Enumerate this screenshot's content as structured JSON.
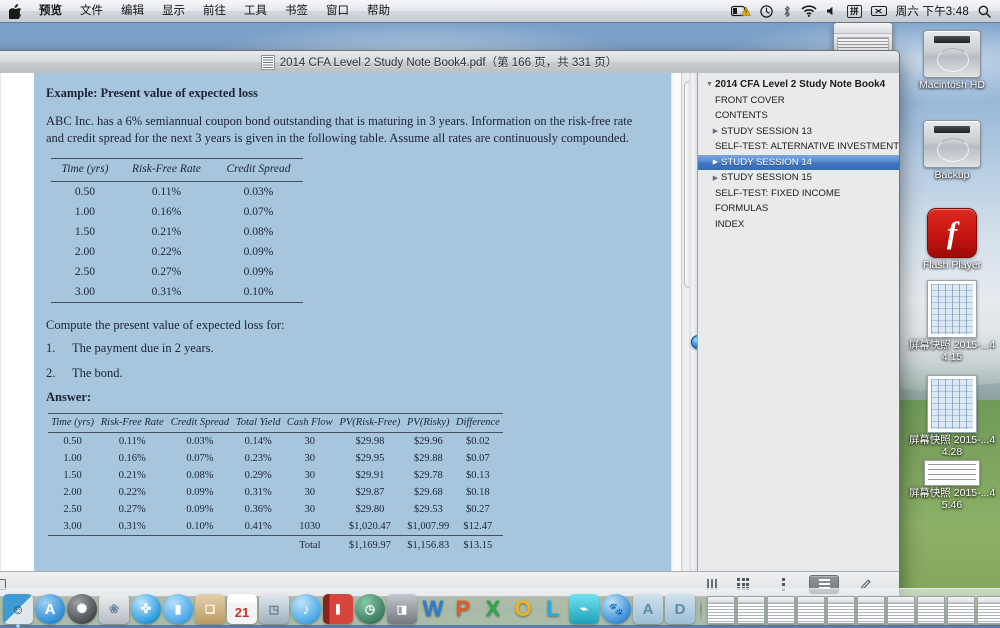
{
  "menubar": {
    "apple_icon": "apple-logo-icon",
    "items": [
      "预览",
      "文件",
      "编辑",
      "显示",
      "前往",
      "工具",
      "书签",
      "窗口",
      "帮助"
    ],
    "app_name": "预览",
    "status": {
      "battery_icon": "battery-warning-icon",
      "timemachine_icon": "time-machine-icon",
      "bluetooth_icon": "bluetooth-icon",
      "wifi_icon": "wifi-icon",
      "volume_icon": "volume-icon",
      "input_method": "拼",
      "input_switch_icon": "input-source-icon",
      "clock": "周六 下午3:48",
      "spotlight_icon": "search-icon"
    }
  },
  "window": {
    "title": "2014 CFA Level 2 Study Note Book4.pdf（第 166 页，共 331 页）",
    "doc_icon": "pdf-document-icon"
  },
  "pdf": {
    "heading": "Example: Present value of expected loss",
    "intro": "ABC Inc. has a 6% semiannual coupon bond outstanding that is maturing in 3 years. Information on the risk-free rate and credit spread for the next 3 years is given in the following table. Assume all rates are continuously compounded.",
    "table1": {
      "headers": [
        "Time (yrs)",
        "Risk-Free Rate",
        "Credit Spread"
      ],
      "rows": [
        [
          "0.50",
          "0.11%",
          "0.03%"
        ],
        [
          "1.00",
          "0.16%",
          "0.07%"
        ],
        [
          "1.50",
          "0.21%",
          "0.08%"
        ],
        [
          "2.00",
          "0.22%",
          "0.09%"
        ],
        [
          "2.50",
          "0.27%",
          "0.09%"
        ],
        [
          "3.00",
          "0.31%",
          "0.10%"
        ]
      ]
    },
    "prompt": "Compute the present value of expected loss for:",
    "list": [
      {
        "num": "1.",
        "text": "The payment due in 2 years."
      },
      {
        "num": "2.",
        "text": "The bond."
      }
    ],
    "answer_label": "Answer:",
    "table2": {
      "headers": [
        "Time (yrs)",
        "Risk-Free Rate",
        "Credit Spread",
        "Total Yield",
        "Cash Flow",
        "PV(Risk-Free)",
        "PV(Risky)",
        "Difference"
      ],
      "rows": [
        [
          "0.50",
          "0.11%",
          "0.03%",
          "0.14%",
          "30",
          "$29.98",
          "$29.96",
          "$0.02"
        ],
        [
          "1.00",
          "0.16%",
          "0.07%",
          "0.23%",
          "30",
          "$29.95",
          "$29.88",
          "$0.07"
        ],
        [
          "1.50",
          "0.21%",
          "0.08%",
          "0.29%",
          "30",
          "$29.91",
          "$29.78",
          "$0.13"
        ],
        [
          "2.00",
          "0.22%",
          "0.09%",
          "0.31%",
          "30",
          "$29.87",
          "$29.68",
          "$0.18"
        ],
        [
          "2.50",
          "0.27%",
          "0.09%",
          "0.36%",
          "30",
          "$29.80",
          "$29.53",
          "$0.27"
        ],
        [
          "3.00",
          "0.31%",
          "0.10%",
          "0.41%",
          "1030",
          "$1,020.47",
          "$1,007.99",
          "$12.47"
        ]
      ],
      "total_row": [
        "",
        "",
        "",
        "",
        "Total",
        "$1,169.97",
        "$1,156.83",
        "$13.15"
      ]
    }
  },
  "sidebar": {
    "items": [
      {
        "label": "2014 CFA Level 2 Study Note Book4",
        "level": 0,
        "twisty": "down",
        "selected": false
      },
      {
        "label": "FRONT COVER",
        "level": 1,
        "twisty": "none",
        "selected": false
      },
      {
        "label": "CONTENTS",
        "level": 1,
        "twisty": "none",
        "selected": false
      },
      {
        "label": "STUDY SESSION 13",
        "level": 1,
        "twisty": "right",
        "selected": false
      },
      {
        "label": "SELF-TEST: ALTERNATIVE INVESTMENTS",
        "level": 1,
        "twisty": "none",
        "selected": false
      },
      {
        "label": "STUDY SESSION 14",
        "level": 1,
        "twisty": "right",
        "selected": true
      },
      {
        "label": "STUDY SESSION 15",
        "level": 1,
        "twisty": "right",
        "selected": false
      },
      {
        "label": "SELF-TEST: FIXED INCOME",
        "level": 1,
        "twisty": "none",
        "selected": false
      },
      {
        "label": "FORMULAS",
        "level": 1,
        "twisty": "none",
        "selected": false
      },
      {
        "label": "INDEX",
        "level": 1,
        "twisty": "none",
        "selected": false
      }
    ],
    "selection_color": "#4076c0"
  },
  "toolbar": {
    "sidebar_toggle_icon": "sidebar-toggle-icon",
    "thumbnail_grid_icon": "grid-view-icon",
    "single_column_icon": "single-column-icon",
    "contact_sheet_icon": "contact-sheet-icon",
    "annotate_icon": "markup-pen-icon",
    "page_bars_icon": "page-bars-icon"
  },
  "desktop_icons": [
    {
      "name": "Macintosh HD",
      "type": "drive"
    },
    {
      "name": "Backup",
      "type": "drive"
    },
    {
      "name": "Flash Player",
      "type": "app"
    },
    {
      "name": "屏幕快照 2015-...44.15",
      "type": "screenshot"
    },
    {
      "name": "屏幕快照 2015-...44.28",
      "type": "screenshot"
    },
    {
      "name": "屏幕快照 2015-...45.46",
      "type": "screenshot-wide"
    }
  ],
  "dock": {
    "apps": [
      {
        "name": "finder-icon",
        "color": "#3e9bd4"
      },
      {
        "name": "app-store-icon",
        "color": "#2f8ed6"
      },
      {
        "name": "system-preferences-icon",
        "color": "#5b5f64"
      },
      {
        "name": "iphoto-icon",
        "color": "#c9ccd1"
      },
      {
        "name": "safari-icon",
        "color": "#2f9fe0"
      },
      {
        "name": "facetime-icon",
        "color": "#49a7ea"
      },
      {
        "name": "contacts-icon",
        "color": "#c9a06a"
      },
      {
        "name": "calendar-icon",
        "color": "#e8eaec",
        "badge": "21"
      },
      {
        "name": "photos-icon",
        "color": "#b9c6cf"
      },
      {
        "name": "itunes-icon",
        "color": "#4aa8e8"
      },
      {
        "name": "ibooks-icon",
        "color": "#b4322c"
      },
      {
        "name": "dashboard-icon",
        "color": "#3f7f63"
      },
      {
        "name": "mission-control-icon",
        "color": "#7e858c"
      },
      {
        "name": "word-icon",
        "color": "#2b7cd3",
        "letter": "W"
      },
      {
        "name": "powerpoint-icon",
        "color": "#e25c2a",
        "letter": "P"
      },
      {
        "name": "excel-icon",
        "color": "#2aa84a",
        "letter": "X"
      },
      {
        "name": "outlook-icon",
        "color": "#f0b31b",
        "letter": "O"
      },
      {
        "name": "lync-icon",
        "color": "#2ba8d8",
        "letter": "L"
      },
      {
        "name": "thunder-icon",
        "color": "#27b5c7"
      },
      {
        "name": "baidu-icon",
        "color": "#3b8fd4"
      },
      {
        "name": "adobe-acrobat-icon",
        "color": "#9dbfd6",
        "letter": "A"
      },
      {
        "name": "adobe-indesign-icon",
        "color": "#9dbfd6",
        "letter": "D"
      }
    ],
    "minimized_windows": 10,
    "trash_icon": "trash-icon"
  }
}
